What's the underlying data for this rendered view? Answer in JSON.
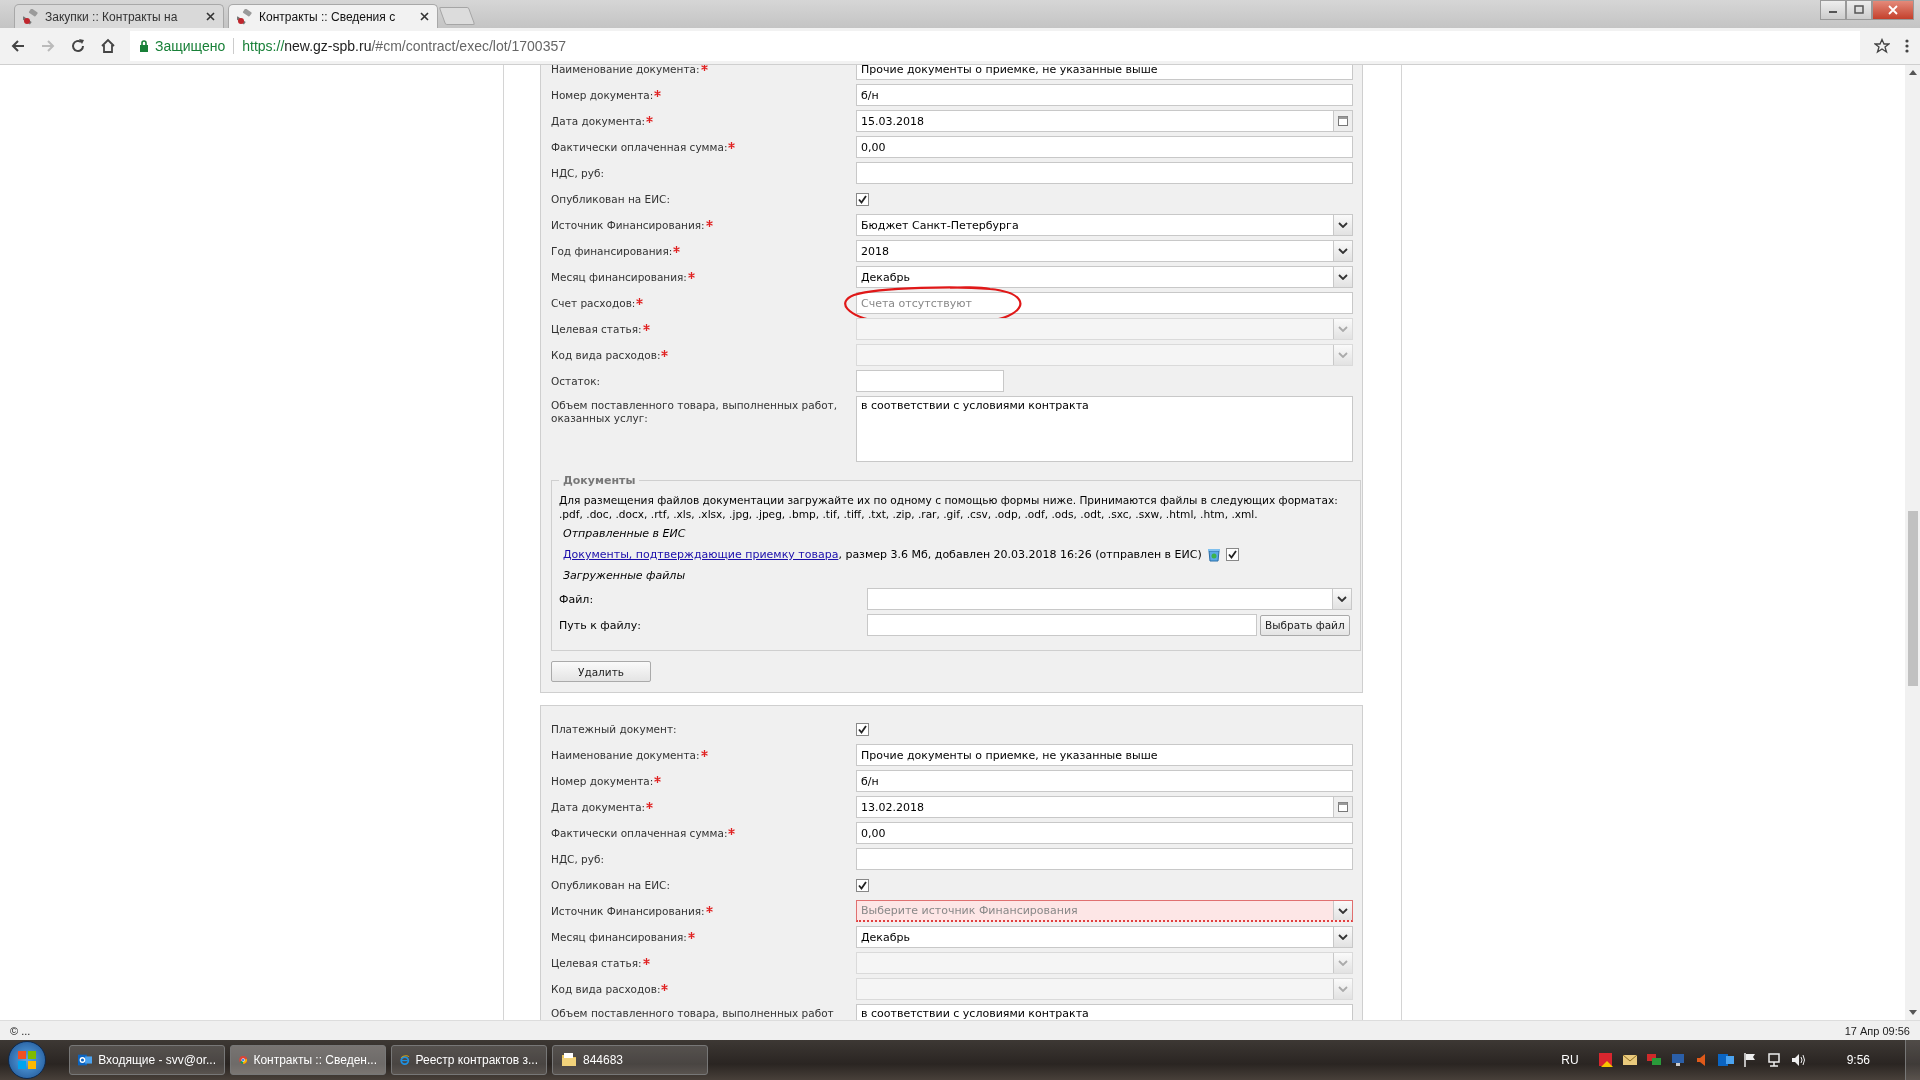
{
  "browser": {
    "tabs": [
      {
        "title": "Закупки :: Контракты на",
        "selected": false
      },
      {
        "title": "Контракты :: Сведения с",
        "selected": true
      }
    ],
    "secure_label": "Защищено",
    "url_scheme": "https://",
    "url_host": "new.gz-spb.ru",
    "url_path": "/#cm/contract/exec/lot/1700357"
  },
  "sections": [
    {
      "rows": [
        {
          "kind": "text",
          "label": "Наименование документа:",
          "required": true,
          "value": "Прочие документы о приемке, не указанные выше"
        },
        {
          "kind": "text",
          "label": "Номер документа:",
          "required": true,
          "value": "б/н"
        },
        {
          "kind": "date",
          "label": "Дата документа:",
          "required": true,
          "value": "15.03.2018"
        },
        {
          "kind": "text",
          "label": "Фактически оплаченная сумма:",
          "required": true,
          "value": "0,00"
        },
        {
          "kind": "text",
          "label": "НДС, руб:",
          "required": false,
          "value": ""
        },
        {
          "kind": "checkbox",
          "label": "Опубликован на ЕИС:",
          "required": false,
          "checked": true
        },
        {
          "kind": "select",
          "label": "Источник Финансирования:",
          "required": true,
          "value": "Бюджет Санкт-Петербурга",
          "disabled": false,
          "invalid": false
        },
        {
          "kind": "select",
          "label": "Год финансирования:",
          "required": true,
          "value": "2018",
          "disabled": false,
          "invalid": false
        },
        {
          "kind": "select",
          "label": "Месяц финансирования:",
          "required": true,
          "value": "Декабрь",
          "disabled": false,
          "invalid": false
        },
        {
          "kind": "text",
          "label": "Счет расходов:",
          "required": true,
          "placeholder": "Счета отсутствуют",
          "circled": true
        },
        {
          "kind": "select",
          "label": "Целевая статья:",
          "required": true,
          "value": "",
          "disabled": true,
          "invalid": false
        },
        {
          "kind": "select",
          "label": "Код вида расходов:",
          "required": true,
          "value": "",
          "disabled": true,
          "invalid": false
        },
        {
          "kind": "short",
          "label": "Остаток:",
          "required": false,
          "value": ""
        },
        {
          "kind": "textarea",
          "label": "Объем поставленного товара, выполненных работ, оказанных услуг:",
          "required": false,
          "value": "в соответствии с условиями контракта"
        }
      ],
      "documents": {
        "legend": "Документы",
        "note": "Для размещения файлов документации загружайте их по одному с помощью формы ниже. Принимаются файлы в следующих форматах: .pdf, .doc, .docx, .rtf, .xls, .xlsx, .jpg, .jpeg, .bmp, .tif, .tiff, .txt, .zip, .rar, .gif, .csv, .odp, .odf, .ods, .odt, .sxc, .sxw, .html, .htm, .xml.",
        "sent_heading": "Отправленные в ЕИС",
        "file_link": "Документы, подтверждающие приемку товара",
        "file_details": ", размер 3.6 Мб, добавлен 20.03.2018 16:26 (отправлен в ЕИС)",
        "file_checked": true,
        "uploaded_heading": "Загруженные файлы",
        "file_label": "Файл:",
        "path_label": "Путь к файлу:",
        "choose_button": "Выбрать файл"
      },
      "delete_button": "Удалить"
    },
    {
      "rows": [
        {
          "kind": "checkbox",
          "label": "Платежный документ:",
          "required": false,
          "checked": true
        },
        {
          "kind": "text",
          "label": "Наименование документа:",
          "required": true,
          "value": "Прочие документы о приемке, не указанные выше"
        },
        {
          "kind": "text",
          "label": "Номер документа:",
          "required": true,
          "value": "б/н"
        },
        {
          "kind": "date",
          "label": "Дата документа:",
          "required": true,
          "value": "13.02.2018"
        },
        {
          "kind": "text",
          "label": "Фактически оплаченная сумма:",
          "required": true,
          "value": "0,00"
        },
        {
          "kind": "text",
          "label": "НДС, руб:",
          "required": false,
          "value": ""
        },
        {
          "kind": "checkbox",
          "label": "Опубликован на ЕИС:",
          "required": false,
          "checked": true
        },
        {
          "kind": "select",
          "label": "Источник Финансирования:",
          "required": true,
          "placeholder": "Выберите источник Финансирования",
          "disabled": false,
          "invalid": true
        },
        {
          "kind": "select",
          "label": "Месяц финансирования:",
          "required": true,
          "value": "Декабрь",
          "disabled": false,
          "invalid": false
        },
        {
          "kind": "select",
          "label": "Целевая статья:",
          "required": true,
          "value": "",
          "disabled": true,
          "invalid": false
        },
        {
          "kind": "select",
          "label": "Код вида расходов:",
          "required": true,
          "value": "",
          "disabled": true,
          "invalid": false
        },
        {
          "kind": "textarea",
          "label": "Объем поставленного товара, выполненных работ",
          "required": false,
          "value": "в соответствии с условиями контракта"
        }
      ]
    }
  ],
  "status_bar": {
    "left": "© ...",
    "right": "17 Апр 09:56"
  },
  "taskbar": {
    "items": [
      {
        "kind": "mail",
        "label": "Входящие - svv@or...",
        "selected": false
      },
      {
        "kind": "chrome",
        "label": "Контракты :: Сведен...",
        "selected": true
      },
      {
        "kind": "ie",
        "label": "Реестр контрактов з...",
        "selected": false
      },
      {
        "kind": "folder",
        "label": "844683",
        "selected": false
      }
    ],
    "language": "RU",
    "time": "9:56"
  }
}
